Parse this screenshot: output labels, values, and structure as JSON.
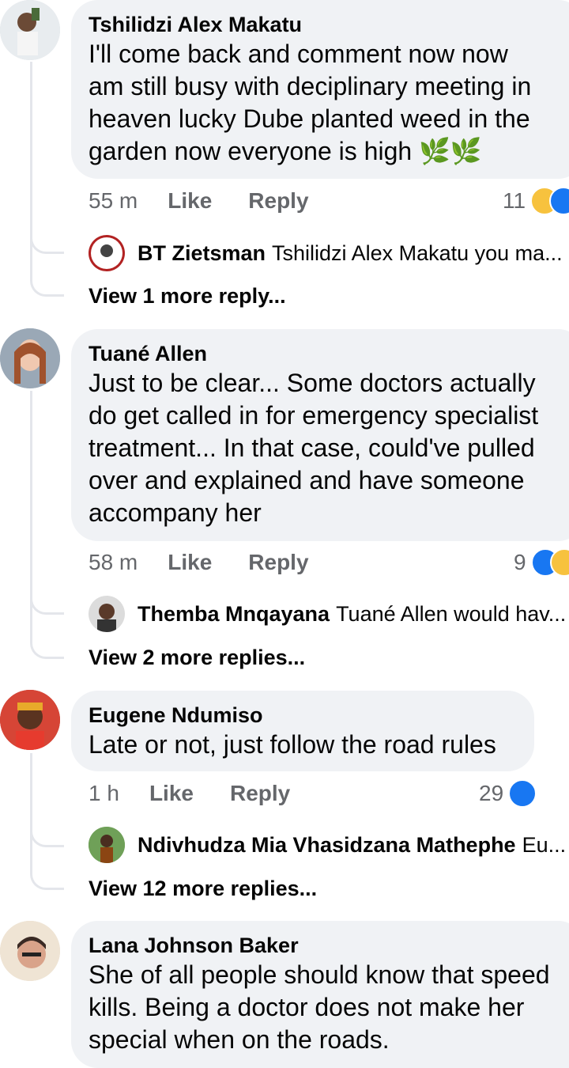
{
  "comments": [
    {
      "author": "Tshilidzi Alex Makatu",
      "text_lines": [
        "I'll come back and comment now now",
        "am still busy with deciplinary meeting in",
        "heaven lucky Dube planted weed in the",
        "garden now everyone is high 🌿🌿"
      ],
      "time": "55 m",
      "like_label": "Like",
      "reply_label": "Reply",
      "reaction_count": "11",
      "reaction_icons": [
        "haha-icon",
        "like-icon"
      ],
      "reply_preview": {
        "author": "BT Zietsman",
        "text": "Tshilidzi Alex Makatu you ma..."
      },
      "view_more": "View 1 more reply..."
    },
    {
      "author": "Tuané Allen",
      "text_lines": [
        "Just to be clear... Some doctors actually",
        "do get called in for emergency specialist",
        "treatment... In that case, could've pulled",
        "over and explained and have someone",
        "accompany her"
      ],
      "time": "58 m",
      "like_label": "Like",
      "reply_label": "Reply",
      "reaction_count": "9",
      "reaction_icons": [
        "like-icon",
        "haha-icon"
      ],
      "reply_preview": {
        "author": "Themba Mnqayana",
        "text": "Tuané Allen would hav..."
      },
      "view_more": "View 2 more replies..."
    },
    {
      "author": "Eugene Ndumiso",
      "text_lines": [
        "Late or not, just follow the road rules"
      ],
      "time": "1 h",
      "like_label": "Like",
      "reply_label": "Reply",
      "reaction_count": "29",
      "reaction_icons": [
        "like-icon"
      ],
      "reply_preview": {
        "author": "Ndivhudza Mia Vhasidzana Mathephe",
        "text": "Eu..."
      },
      "view_more": "View 12 more replies..."
    },
    {
      "author": "Lana Johnson Baker",
      "text_lines": [
        "She of all people should know that speed",
        "kills.  Being a doctor does not make her",
        "special when on the roads."
      ]
    }
  ],
  "colors": {
    "bubble": "#f0f2f5",
    "meta_text": "#65676b",
    "like_blue": "#1877f2",
    "haha_yellow": "#f7c23e"
  }
}
